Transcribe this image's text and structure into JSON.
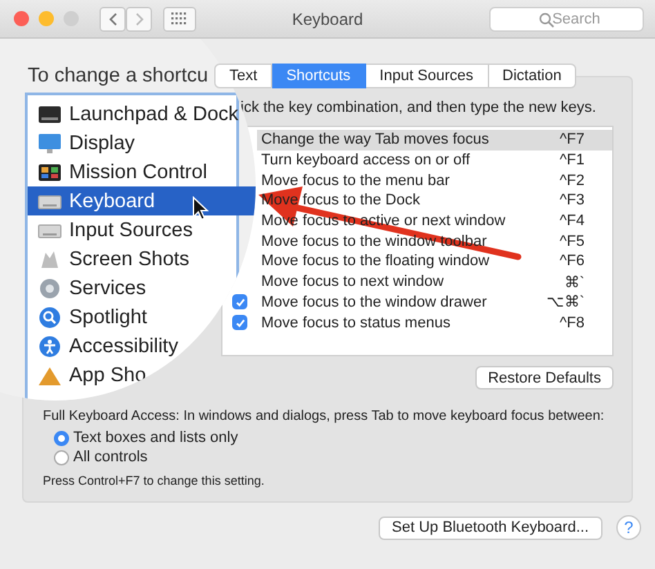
{
  "window": {
    "title": "Keyboard",
    "search": {
      "placeholder": "Search"
    }
  },
  "heading": "To change a shortcu",
  "tabs": [
    {
      "label": "Text",
      "selected": false
    },
    {
      "label": "Shortcuts",
      "selected": true
    },
    {
      "label": "Input Sources",
      "selected": false
    },
    {
      "label": "Dictation",
      "selected": false
    }
  ],
  "instruction": "ick the key combination, and then type the new keys.",
  "categories": [
    {
      "label": "Launchpad & Dock",
      "selected": false
    },
    {
      "label": "Display",
      "selected": false
    },
    {
      "label": "Mission Control",
      "selected": false
    },
    {
      "label": "Keyboard",
      "selected": true
    },
    {
      "label": "Input Sources",
      "selected": false
    },
    {
      "label": "Screen Shots",
      "selected": false
    },
    {
      "label": "Services",
      "selected": false
    },
    {
      "label": "Spotlight",
      "selected": false
    },
    {
      "label": "Accessibility",
      "selected": false
    },
    {
      "label": "App Sho",
      "selected": false
    }
  ],
  "shortcuts": [
    {
      "label": "Change the way Tab moves focus",
      "keys": "^F7",
      "selected": true
    },
    {
      "label": "Turn keyboard access on or off",
      "keys": "^F1",
      "selected": false
    },
    {
      "label": "Move focus to the menu bar",
      "keys": "^F2",
      "selected": false
    },
    {
      "label": "Move focus to the Dock",
      "keys": "^F3",
      "selected": false
    },
    {
      "label": "Move focus to active or next window",
      "keys": "^F4",
      "selected": false
    },
    {
      "label": "Move focus to the window toolbar",
      "keys": "^F5",
      "selected": false
    },
    {
      "label": "Move focus to the floating window",
      "keys": "^F6",
      "selected": false
    },
    {
      "label": "Move focus to next window",
      "keys": "⌘`",
      "selected": false
    },
    {
      "label": "Move focus to the window drawer",
      "keys": "⌥⌘`",
      "selected": false,
      "checked": true
    },
    {
      "label": "Move focus to status menus",
      "keys": "^F8",
      "selected": false,
      "checked": true
    }
  ],
  "restore_button": "Restore Defaults",
  "full_keyboard_access": {
    "label": "Full Keyboard Access: In windows and dialogs, press Tab to move keyboard focus between:",
    "options": [
      {
        "label": "Text boxes and lists only",
        "selected": true
      },
      {
        "label": "All controls",
        "selected": false
      }
    ],
    "note": "Press Control+F7 to change this setting."
  },
  "bluetooth_button": "Set Up Bluetooth Keyboard...",
  "help_button": "?"
}
